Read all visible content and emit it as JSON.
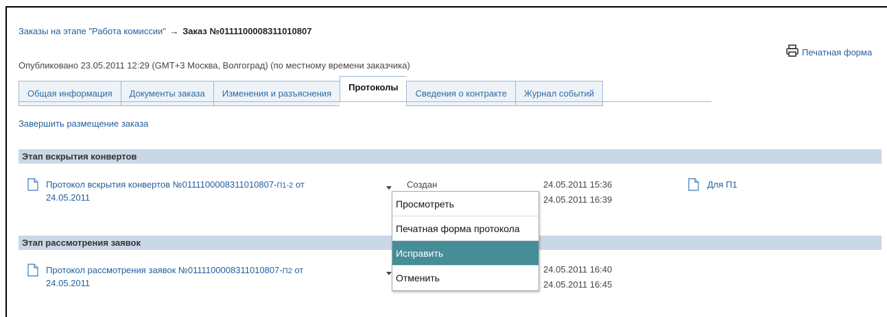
{
  "breadcrumb": {
    "link": "Заказы на этапе \"Работа комиссии\"",
    "arrow": "→",
    "current": "Заказ №0111100008311010807"
  },
  "print_form": {
    "label": "Печатная форма",
    "icon": "printer-icon"
  },
  "published": "Опубликовано 23.05.2011 12:29 (GMT+3 Москва, Волгоград) (по местному времени заказчика)",
  "tabs": [
    {
      "label": "Общая информация"
    },
    {
      "label": "Документы заказа"
    },
    {
      "label": "Изменения и разъяснения"
    },
    {
      "label": "Протоколы"
    },
    {
      "label": "Сведения о контракте"
    },
    {
      "label": "Журнал событий"
    }
  ],
  "active_tab": "Протоколы",
  "finish_link": "Завершить размещение заказа",
  "sections": [
    {
      "title": "Этап вскрытия конвертов",
      "row": {
        "link_main": "Протокол вскрытия конвертов №0111100008311010807-",
        "link_code": "П1-2",
        "link_tail": " от",
        "link_date": "24.05.2011",
        "status": "Создан",
        "date1": "24.05.2011 15:36",
        "date2": "24.05.2011 16:39",
        "attachment": "Для П1"
      }
    },
    {
      "title": "Этап рассмотрения заявок",
      "row": {
        "link_main": "Протокол рассмотрения заявок №0111100008311010807-",
        "link_code": "П2",
        "link_tail": " от",
        "link_date": "24.05.2011",
        "date1": "24.05.2011 16:40",
        "date2": "24.05.2011 16:45"
      }
    }
  ],
  "context_menu": {
    "items": [
      {
        "label": "Просмотреть"
      },
      {
        "label": "Печатная форма протокола"
      },
      {
        "label": "Исправить",
        "highlighted": true
      },
      {
        "label": "Отменить"
      }
    ],
    "highlight_color": "#458d97"
  }
}
